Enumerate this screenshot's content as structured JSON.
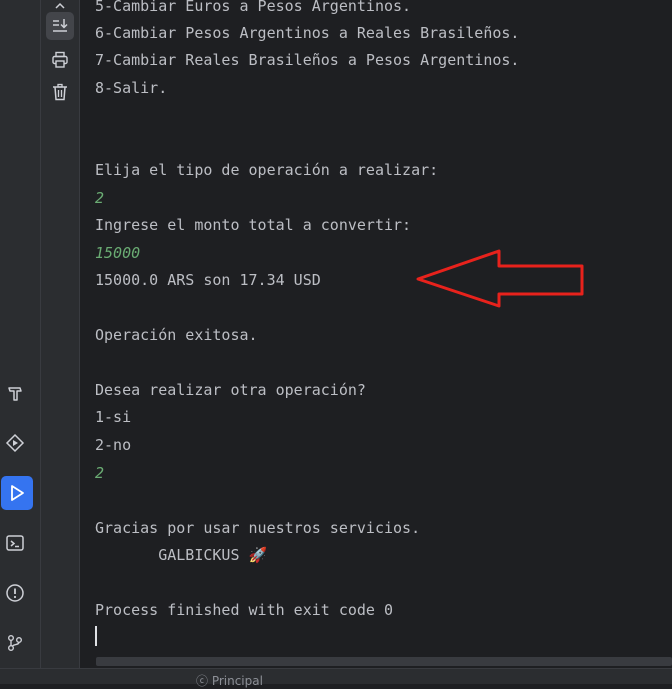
{
  "console": {
    "lines": [
      "5-Cambiar Euros a Pesos Argentinos.",
      "6-Cambiar Pesos Argentinos a Reales Brasileños.",
      "7-Cambiar Reales Brasileños a Pesos Argentinos.",
      "8-Salir.",
      "Elija el tipo de operación a realizar:",
      "2",
      "Ingrese el monto total a convertir:",
      "15000",
      "15000.0 ARS son 17.34 USD",
      "Operación exitosa.",
      "Desea realizar otra operación?",
      "1-si",
      "2-no",
      "2",
      "Gracias por usar nuestros servicios.",
      "       GALBICKUS 🚀",
      "Process finished with exit code 0"
    ]
  },
  "annotation": {
    "color": "#e8221c"
  },
  "colors": {
    "background": "#1e1f22",
    "text": "#bcbec4",
    "user_input": "#6aab73",
    "accent": "#3574f0"
  },
  "icons": {
    "toolbar": [
      "scroll-to-end-icon",
      "print-icon",
      "trash-icon"
    ],
    "sidebar": [
      "build-hammer-icon",
      "services-icon",
      "run-icon",
      "terminal-icon",
      "problems-icon",
      "git-icon"
    ]
  },
  "statusbar": {
    "breadcrumb": "ⓒ Principal"
  }
}
